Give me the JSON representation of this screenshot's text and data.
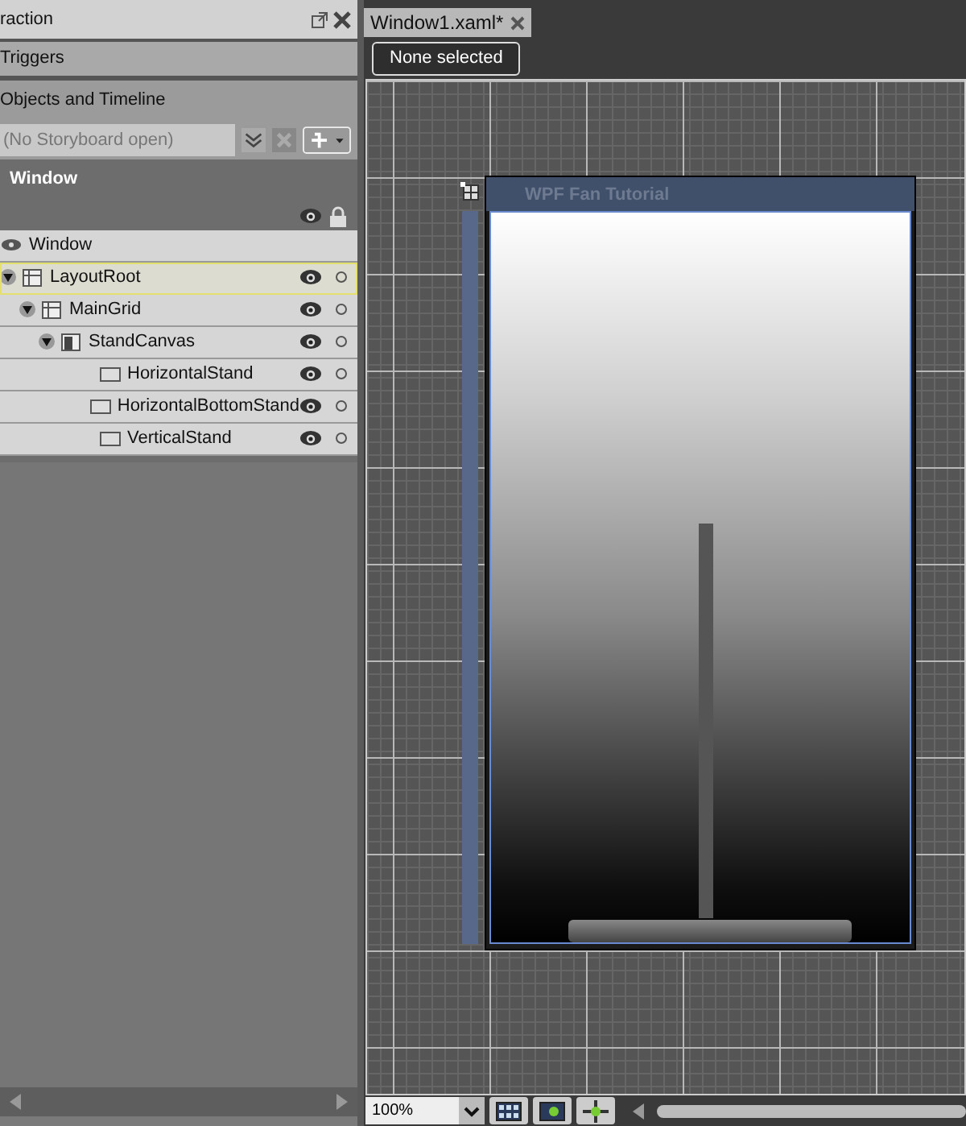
{
  "left_panel": {
    "header_tab": {
      "label": "raction"
    },
    "triggers": {
      "label": "Triggers"
    },
    "objects_header": {
      "label": "Objects and Timeline"
    },
    "storyboard": {
      "placeholder": "(No Storyboard open)"
    },
    "scope": {
      "label": "Window"
    },
    "root_item": {
      "label": "Window"
    },
    "tree": [
      {
        "label": "LayoutRoot",
        "kind": "grid",
        "expanded": true,
        "selected": true,
        "children": [
          {
            "label": "MainGrid",
            "kind": "grid",
            "expanded": true,
            "selected": false,
            "children": [
              {
                "label": "StandCanvas",
                "kind": "canvas",
                "expanded": true,
                "selected": false,
                "children": [
                  {
                    "label": "HorizontalStand",
                    "kind": "rect",
                    "selected": false
                  },
                  {
                    "label": "HorizontalBottomStand",
                    "kind": "rect",
                    "selected": false
                  },
                  {
                    "label": "VerticalStand",
                    "kind": "rect",
                    "selected": false
                  }
                ]
              }
            ]
          }
        ]
      }
    ]
  },
  "document_tab": {
    "label": "Window1.xaml*"
  },
  "selection_button": {
    "label": "None selected"
  },
  "design_window": {
    "title": "WPF Fan Tutorial"
  },
  "zoom": {
    "value": "100%"
  }
}
